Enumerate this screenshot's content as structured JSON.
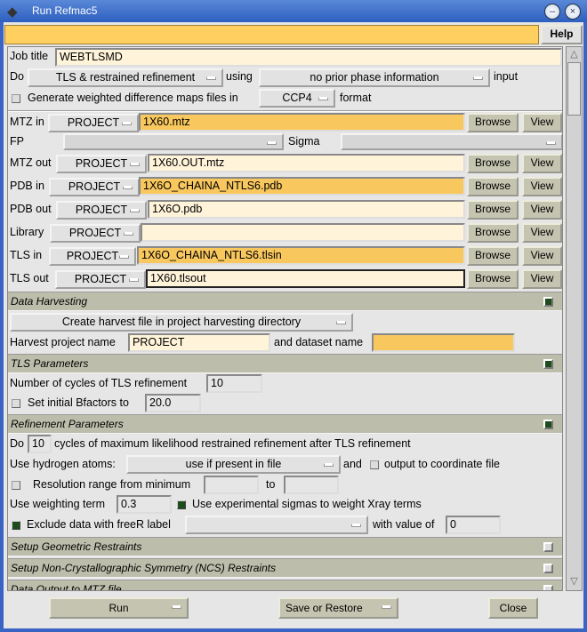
{
  "window": {
    "title": "Run Refmac5",
    "help": "Help"
  },
  "job": {
    "label": "Job title",
    "value": "WEBTLSMD"
  },
  "do_row": {
    "do": "Do",
    "mode": "TLS & restrained refinement",
    "using": "using",
    "phase": "no prior phase information",
    "input": "input"
  },
  "maps": {
    "label": "Generate weighted difference maps files in",
    "format_value": "CCP4",
    "format": "format",
    "checked": false
  },
  "files": [
    {
      "label": "MTZ in",
      "project": "PROJECT",
      "value": "1X60.mtz",
      "highlight": true
    },
    {
      "label": "MTZ out",
      "project": "PROJECT",
      "value": "1X60.OUT.mtz",
      "highlight": false
    },
    {
      "label": "PDB in",
      "project": "PROJECT",
      "value": "1X6O_CHAINA_NTLS6.pdb",
      "highlight": true
    },
    {
      "label": "PDB out",
      "project": "PROJECT",
      "value": "1X6O.pdb",
      "highlight": false
    },
    {
      "label": "Library",
      "project": "PROJECT",
      "value": "",
      "highlight": false
    },
    {
      "label": "TLS in",
      "project": "PROJECT",
      "value": "1X6O_CHAINA_NTLS6.tlsin",
      "highlight": true
    },
    {
      "label": "TLS out",
      "project": "PROJECT",
      "value": "1X60.tlsout",
      "highlight": false
    }
  ],
  "browse": "Browse",
  "view": "View",
  "fp": {
    "label": "FP",
    "value": "",
    "sigma": "Sigma",
    "sigma_value": ""
  },
  "harvest": {
    "header": "Data Harvesting",
    "expanded": true,
    "mode": "Create harvest file in project harvesting directory",
    "project_label": "Harvest project name",
    "project": "PROJECT",
    "dataset_label": "and dataset name",
    "dataset": ""
  },
  "tls": {
    "header": "TLS Parameters",
    "expanded": true,
    "cycles_label": "Number of cycles of TLS refinement",
    "cycles": "10",
    "bfac_label": "Set initial Bfactors to",
    "bfac": "20.0",
    "bfac_checked": false
  },
  "refine": {
    "header": "Refinement Parameters",
    "expanded": true,
    "do": "Do",
    "cycles": "10",
    "cycles_label": "cycles of maximum likelihood restrained refinement after TLS refinement",
    "hyd_label": "Use hydrogen atoms:",
    "hyd": "use if present in file",
    "and": "and",
    "out_label": "output to coordinate file",
    "out_checked": false,
    "res_label": "Resolution range from minimum",
    "res_min": "",
    "to": "to",
    "res_max": "",
    "res_checked": false,
    "weight_label": "Use weighting term",
    "weight": "0.3",
    "sig_label": "Use experimental sigmas to weight Xray terms",
    "sig_checked": true,
    "free_label": "Exclude data with freeR label",
    "free": "",
    "free_checked": true,
    "val_label": "with value of",
    "val": "0"
  },
  "sections": [
    {
      "header": "Setup Geometric Restraints",
      "expanded": false
    },
    {
      "header": "Setup Non-Crystallographic Symmetry (NCS) Restraints",
      "expanded": false
    },
    {
      "header": "Data Output to MTZ file",
      "expanded": false
    }
  ],
  "footer": {
    "run": "Run",
    "save": "Save or Restore",
    "close": "Close"
  }
}
